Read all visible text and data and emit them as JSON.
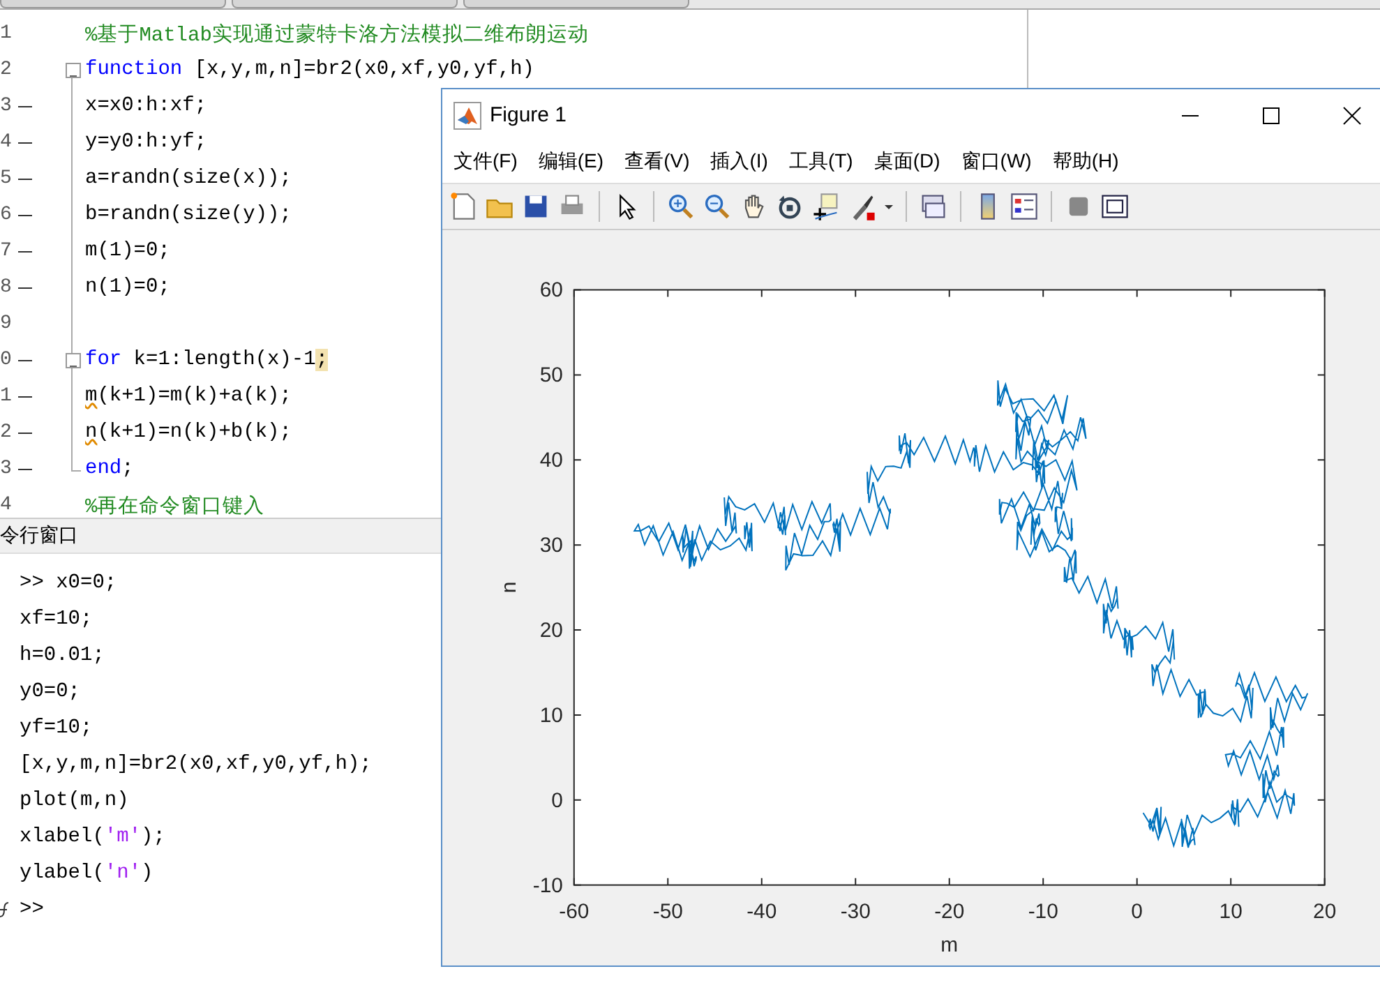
{
  "editor": {
    "lines": [
      {
        "number": "1",
        "dash": false,
        "fold_toggle": false,
        "fold_end": false,
        "tokens": [
          {
            "text": "%基于Matlab实现通过蒙特卡洛方法模拟二维布朗运动",
            "kind": "comment"
          }
        ]
      },
      {
        "number": "2",
        "dash": false,
        "fold_toggle": true,
        "fold_end": false,
        "tokens": [
          {
            "text": "function",
            "kind": "keyword"
          },
          {
            "text": " [x,y,m,n]=br2(x0,xf,y0,yf,h)",
            "kind": "plain"
          }
        ]
      },
      {
        "number": "3",
        "dash": true,
        "fold_toggle": false,
        "fold_end": false,
        "tokens": [
          {
            "text": "x=x0:h:xf;",
            "kind": "plain"
          }
        ]
      },
      {
        "number": "4",
        "dash": true,
        "fold_toggle": false,
        "fold_end": false,
        "tokens": [
          {
            "text": "y=y0:h:yf;",
            "kind": "plain"
          }
        ]
      },
      {
        "number": "5",
        "dash": true,
        "fold_toggle": false,
        "fold_end": false,
        "tokens": [
          {
            "text": "a=randn(size(x));",
            "kind": "plain"
          }
        ]
      },
      {
        "number": "6",
        "dash": true,
        "fold_toggle": false,
        "fold_end": false,
        "tokens": [
          {
            "text": "b=randn(size(y));",
            "kind": "plain"
          }
        ]
      },
      {
        "number": "7",
        "dash": true,
        "fold_toggle": false,
        "fold_end": false,
        "tokens": [
          {
            "text": "m(1)=0;",
            "kind": "plain"
          }
        ]
      },
      {
        "number": "8",
        "dash": true,
        "fold_toggle": false,
        "fold_end": false,
        "tokens": [
          {
            "text": "n(1)=0;",
            "kind": "plain"
          }
        ]
      },
      {
        "number": "9",
        "dash": false,
        "fold_toggle": false,
        "fold_end": false
      },
      {
        "number": "0",
        "dash": true,
        "fold_toggle": true,
        "fold_end": false,
        "tokens": [
          {
            "text": "for",
            "kind": "keyword"
          },
          {
            "text": " k=1:length(x)-1",
            "kind": "plain"
          },
          {
            "text": ";",
            "kind": "warning"
          }
        ]
      },
      {
        "number": "1",
        "dash": true,
        "fold_toggle": false,
        "fold_end": false,
        "tokens": [
          {
            "text": "m",
            "kind": "squiggle"
          },
          {
            "text": "(k+1)=m(k)+a(k);",
            "kind": "plain"
          }
        ]
      },
      {
        "number": "2",
        "dash": true,
        "fold_toggle": false,
        "fold_end": false,
        "tokens": [
          {
            "text": "n",
            "kind": "squiggle"
          },
          {
            "text": "(k+1)=n(k)+b(k);",
            "kind": "plain"
          }
        ]
      },
      {
        "number": "3",
        "dash": true,
        "fold_toggle": false,
        "fold_end": true,
        "tokens": [
          {
            "text": "end",
            "kind": "keyword"
          },
          {
            "text": ";",
            "kind": "plain"
          }
        ]
      },
      {
        "number": "4",
        "dash": false,
        "fold_toggle": false,
        "fold_end": false,
        "tokens": [
          {
            "text": "%再在命令窗口键入",
            "kind": "comment"
          }
        ]
      }
    ]
  },
  "command_window": {
    "title": "令行窗口",
    "lines": [
      {
        "tokens": [
          {
            "text": ">> x0=0;",
            "kind": "plain"
          }
        ]
      },
      {
        "tokens": [
          {
            "text": "xf=10;",
            "kind": "plain"
          }
        ]
      },
      {
        "tokens": [
          {
            "text": "h=0.01;",
            "kind": "plain"
          }
        ]
      },
      {
        "tokens": [
          {
            "text": "y0=0;",
            "kind": "plain"
          }
        ]
      },
      {
        "tokens": [
          {
            "text": "yf=10;",
            "kind": "plain"
          }
        ]
      },
      {
        "tokens": [
          {
            "text": "[x,y,m,n]=br2(x0,xf,y0,yf,h);",
            "kind": "plain"
          }
        ]
      },
      {
        "tokens": [
          {
            "text": "plot(m,n)",
            "kind": "plain"
          }
        ]
      },
      {
        "tokens": [
          {
            "text": "xlabel(",
            "kind": "plain"
          },
          {
            "text": "'m'",
            "kind": "string"
          },
          {
            "text": ");",
            "kind": "plain"
          }
        ]
      },
      {
        "tokens": [
          {
            "text": "ylabel(",
            "kind": "plain"
          },
          {
            "text": "'n'",
            "kind": "string"
          },
          {
            "text": ")",
            "kind": "plain"
          }
        ]
      },
      {
        "tokens": [
          {
            "text": ">>",
            "kind": "plain"
          }
        ]
      }
    ]
  },
  "figure": {
    "title": "Figure 1",
    "menu": [
      "文件(F)",
      "编辑(E)",
      "查看(V)",
      "插入(I)",
      "工具(T)",
      "桌面(D)",
      "窗口(W)",
      "帮助(H)"
    ],
    "axes": {
      "xlabel": "m",
      "ylabel": "n",
      "xticks": [
        "-60",
        "-50",
        "-40",
        "-30",
        "-20",
        "-10",
        "0",
        "10",
        "20"
      ],
      "yticks": [
        "60",
        "50",
        "40",
        "30",
        "20",
        "10",
        "0",
        "-10"
      ]
    }
  }
}
